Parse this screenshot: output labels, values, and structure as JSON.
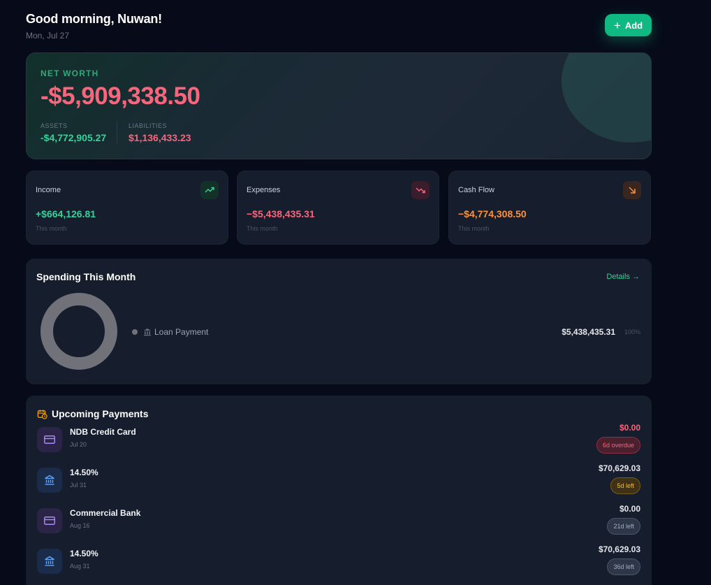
{
  "header": {
    "greeting": "Good morning, Nuwan!",
    "date": "Mon, Jul 27",
    "add_label": "Add"
  },
  "net_worth": {
    "label": "NET WORTH",
    "value": "-$5,909,338.50",
    "assets_label": "ASSETS",
    "assets_value": "-$4,772,905.27",
    "liabilities_label": "LIABILITIES",
    "liabilities_value": "$1,136,433.23"
  },
  "stats": [
    {
      "title": "Income",
      "value": "+$664,126.81",
      "sub": "This month",
      "icon": "trending-up-icon",
      "color": "#34d399"
    },
    {
      "title": "Expenses",
      "value": "−$5,438,435.31",
      "sub": "This month",
      "icon": "trending-down-icon",
      "color": "#f7667c"
    },
    {
      "title": "Cash Flow",
      "value": "−$4,774,308.50",
      "sub": "This month",
      "icon": "arrow-down-right-icon",
      "color": "#fb923c"
    }
  ],
  "spending": {
    "title": "Spending This Month",
    "details_label": "Details →",
    "items": [
      {
        "category": "Loan Payment",
        "icon": "bank-icon",
        "amount": "$5,438,435.31",
        "percent": "100%",
        "color": "#71717a"
      }
    ]
  },
  "upcoming": {
    "title": "Upcoming Payments",
    "items": [
      {
        "name": "NDB Credit Card",
        "date": "Jul 20",
        "amount": "$0.00",
        "badge": "6d overdue",
        "icon": "credit-card-icon",
        "status": "overdue"
      },
      {
        "name": "14.50%",
        "date": "Jul 31",
        "amount": "$70,629.03",
        "badge": "5d left",
        "icon": "bank-icon",
        "status": "soon"
      },
      {
        "name": "Commercial Bank",
        "date": "Aug 16",
        "amount": "$0.00",
        "badge": "21d left",
        "icon": "credit-card-icon",
        "status": "normal"
      },
      {
        "name": "14.50%",
        "date": "Aug 31",
        "amount": "$70,629.03",
        "badge": "36d left",
        "icon": "bank-icon",
        "status": "normal"
      }
    ]
  },
  "colors": {
    "accent": "#10b981",
    "negative": "#f7667c",
    "positive": "#34d399",
    "warning": "#fb923c",
    "background": "#070b19",
    "card": "#161d2d"
  }
}
